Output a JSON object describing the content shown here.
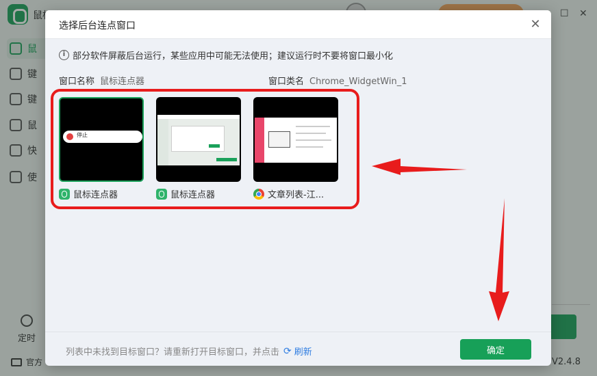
{
  "app": {
    "title": "鼠标连点器",
    "sidebar": [
      {
        "label": "鼠"
      },
      {
        "label": "键"
      },
      {
        "label": "键"
      },
      {
        "label": "鼠"
      },
      {
        "label": "快"
      },
      {
        "label": "使"
      }
    ],
    "timer_label": "定时",
    "footer_left": "官方",
    "version": "V2.4.8"
  },
  "dialog": {
    "title": "选择后台连点窗口",
    "notice": "部分软件屏蔽后台运行，某些应用中可能无法使用；建议运行时不要将窗口最小化",
    "window_name_label": "窗口名称",
    "window_name_value": "鼠标连点器",
    "window_class_label": "窗口类名",
    "window_class_value": "Chrome_WidgetWin_1",
    "windows": [
      {
        "label": "鼠标连点器",
        "icon": "mouse-clicker-app-icon",
        "selected": true,
        "thumb_text": "停止"
      },
      {
        "label": "鼠标连点器",
        "icon": "mouse-clicker-app-icon",
        "selected": false
      },
      {
        "label": "文章列表-江...",
        "icon": "chrome-icon",
        "selected": false
      }
    ],
    "footer_text": "列表中未找到目标窗口？请重新打开目标窗口，并点击",
    "refresh_label": "刷新",
    "confirm_label": "确定"
  },
  "colors": {
    "accent_green": "#17a058",
    "link_blue": "#2f7de1",
    "annotation_red": "#e81c1c"
  }
}
